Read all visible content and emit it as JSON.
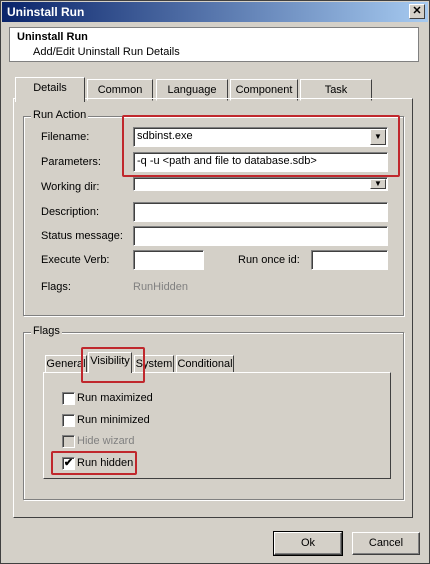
{
  "window": {
    "title": "Uninstall Run",
    "close_glyph": "✕"
  },
  "header": {
    "title": "Uninstall Run",
    "subtitle": "Add/Edit Uninstall Run Details"
  },
  "tabs": [
    "Details",
    "Common",
    "Language",
    "Component",
    "Task"
  ],
  "active_tab": "Details",
  "run_action": {
    "group_label": "Run Action",
    "filename_label": "Filename:",
    "filename_value": "sdbinst.exe",
    "parameters_label": "Parameters:",
    "parameters_value": "-q -u <path and file to database.sdb>",
    "working_dir_label": "Working dir:",
    "working_dir_value": "",
    "description_label": "Description:",
    "description_value": "",
    "status_message_label": "Status message:",
    "status_message_value": "",
    "execute_verb_label": "Execute Verb:",
    "execute_verb_value": "",
    "run_once_id_label": "Run once id:",
    "run_once_id_value": "",
    "flags_label": "Flags:",
    "flags_value": "RunHidden"
  },
  "flags": {
    "group_label": "Flags",
    "tabs": [
      "General",
      "Visibility",
      "System",
      "Conditional"
    ],
    "active_tab": "Visibility",
    "options": [
      {
        "label": "Run maximized",
        "checked": false,
        "disabled": false
      },
      {
        "label": "Run minimized",
        "checked": false,
        "disabled": false
      },
      {
        "label": "Hide wizard",
        "checked": false,
        "disabled": true
      },
      {
        "label": "Run hidden",
        "checked": true,
        "disabled": false
      }
    ]
  },
  "buttons": {
    "ok": "Ok",
    "cancel": "Cancel"
  },
  "icons": {
    "dropdown": "▼",
    "check": "✔"
  },
  "colors": {
    "highlight_box": "#c0282d",
    "title_bar": "#0a246a",
    "dialog_bg": "#d4d0c8"
  }
}
